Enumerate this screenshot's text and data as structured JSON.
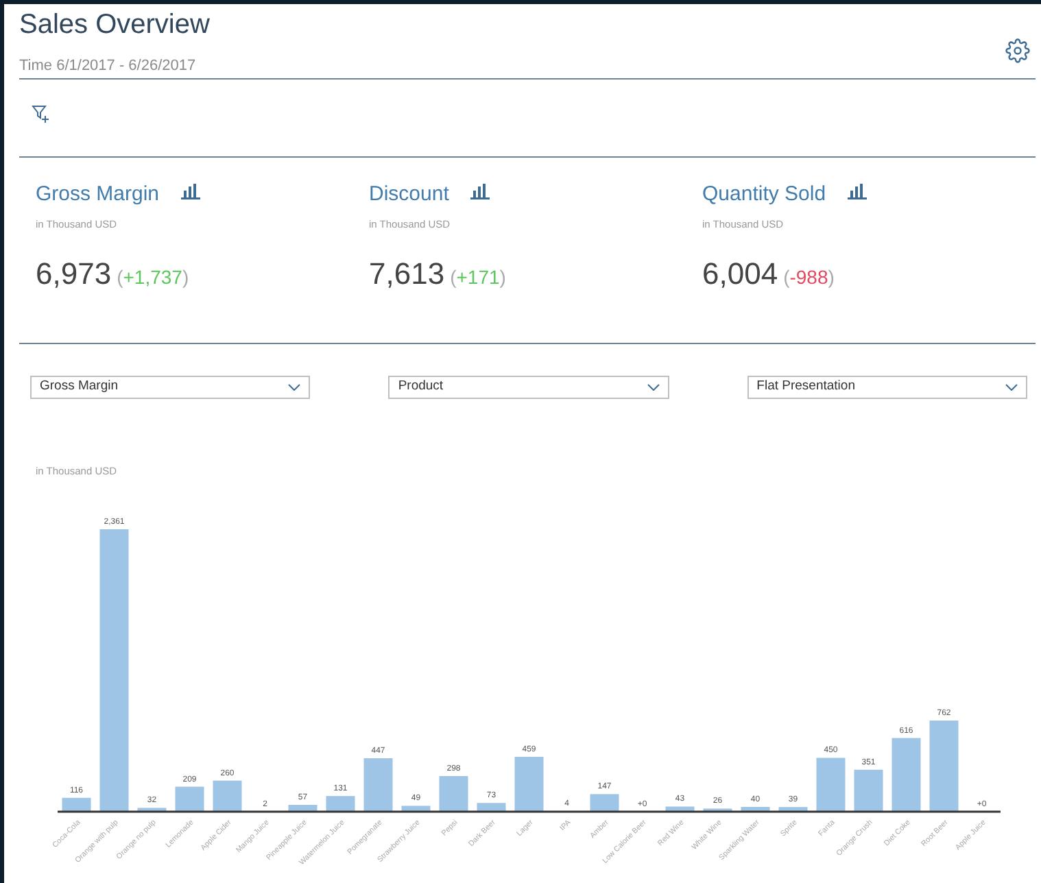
{
  "header": {
    "title": "Sales Overview",
    "subtitle": "Time 6/1/2017 - 6/26/2017"
  },
  "kpis": [
    {
      "title": "Gross Margin",
      "unit": "in Thousand USD",
      "value": "6,973",
      "open": "(",
      "delta": "+1,737",
      "close": ")",
      "color": "#5dc65d"
    },
    {
      "title": "Discount",
      "unit": "in Thousand USD",
      "value": "7,613",
      "open": "(",
      "delta": "+171",
      "close": ")",
      "color": "#5dc65d"
    },
    {
      "title": "Quantity Sold",
      "unit": "in Thousand USD",
      "value": "6,004",
      "open": "(",
      "delta": "-988",
      "close": ")",
      "color": "#e5475e"
    }
  ],
  "selects": [
    {
      "value": "Gross Margin"
    },
    {
      "value": "Product"
    },
    {
      "value": "Flat Presentation"
    }
  ],
  "chart": {
    "unit": "in Thousand USD",
    "chart_data": {
      "type": "bar",
      "categories": [
        "Coca-Cola",
        "Orange with pulp",
        "Orange no pulp",
        "Lemonade",
        "Apple Cider",
        "Mango Juice",
        "Pineapple Juice",
        "Watermelon Juice",
        "Pomegranate",
        "Strawberry Juice",
        "Pepsi",
        "Dark Beer",
        "Lager",
        "IPA",
        "Amber",
        "Low Calorie Beer",
        "Red Wine",
        "White Wine",
        "Sparkling Water",
        "Sprite",
        "Fanta",
        "Orange Crush",
        "Diet Coke",
        "Root Beer",
        "Apple Juice"
      ],
      "values": [
        116,
        2361,
        32,
        209,
        260,
        2,
        57,
        131,
        447,
        49,
        298,
        73,
        459,
        4,
        147,
        0,
        43,
        26,
        40,
        39,
        450,
        351,
        616,
        762,
        0
      ],
      "value_labels": [
        "116",
        "2,361",
        "32",
        "209",
        "260",
        "2",
        "57",
        "131",
        "447",
        "49",
        "298",
        "73",
        "459",
        "4",
        "147",
        "+0",
        "43",
        "26",
        "40",
        "39",
        "450",
        "351",
        "616",
        "762",
        "+0"
      ]
    }
  }
}
